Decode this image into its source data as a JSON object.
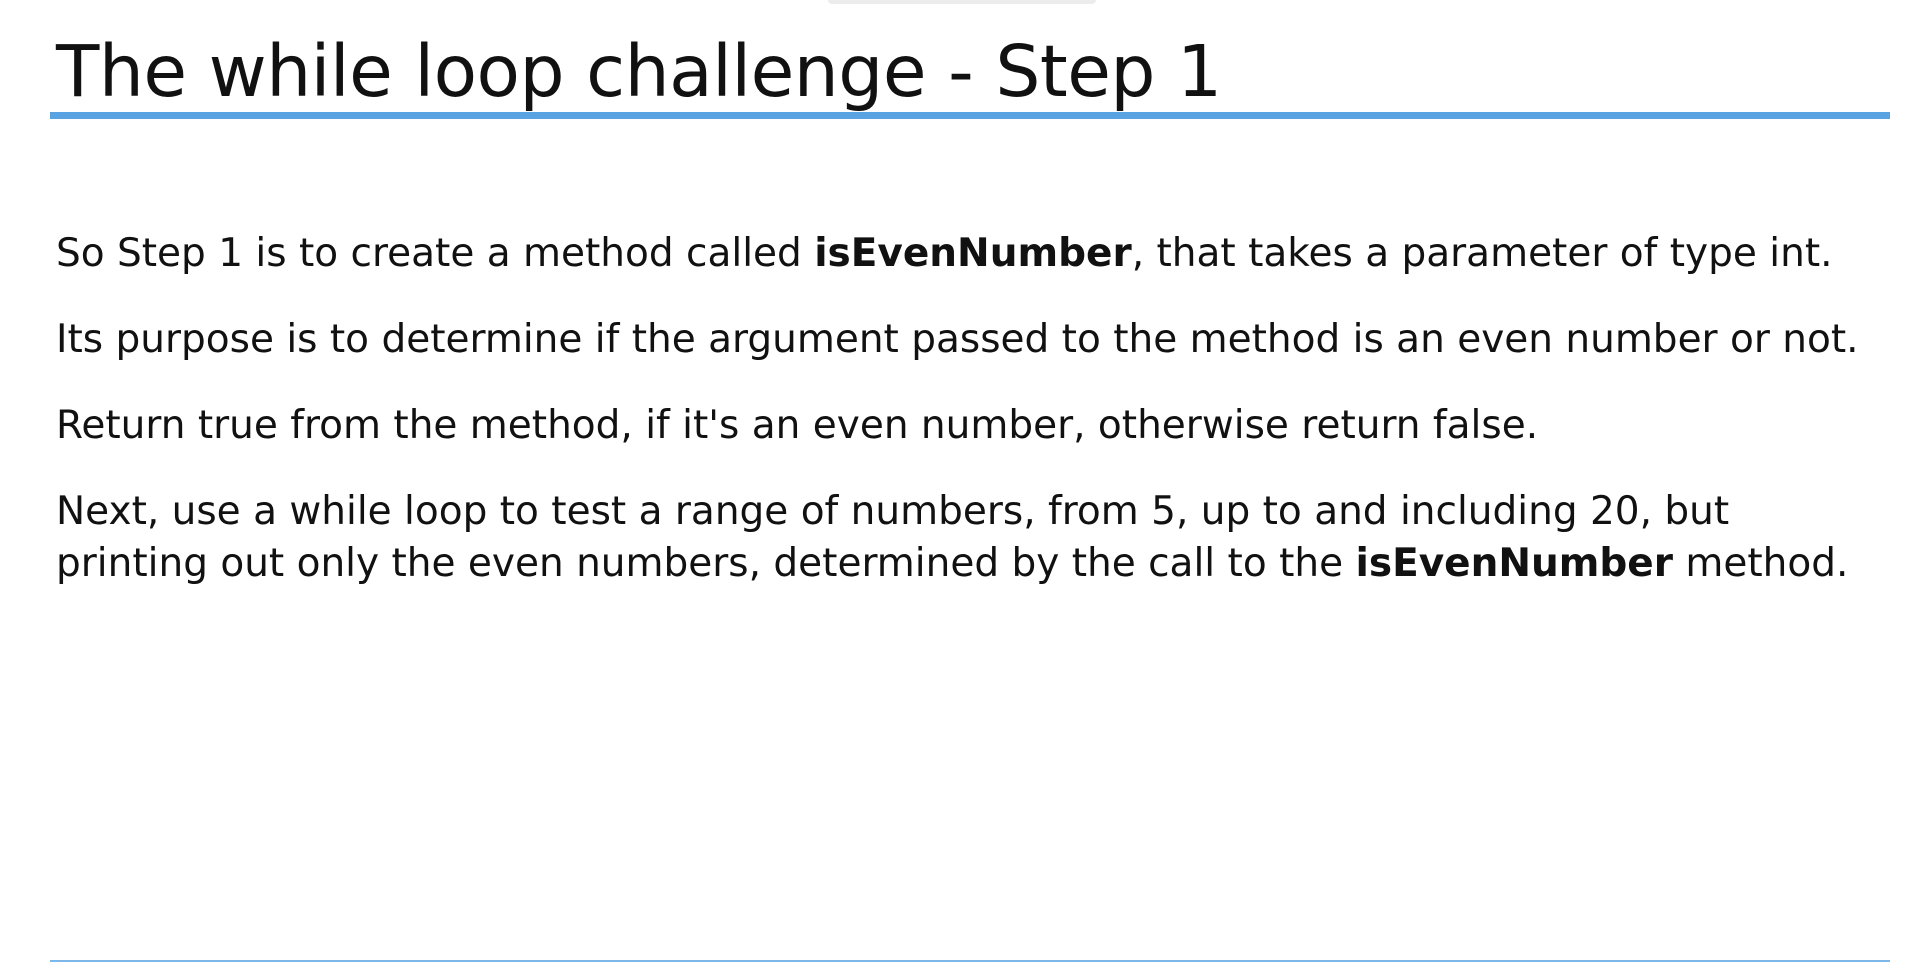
{
  "slide": {
    "title": "The while loop challenge - Step 1",
    "accent_color": "#5aa3e3",
    "paragraphs": [
      {
        "before": "So Step 1 is to create a method called ",
        "bold": "isEvenNumber",
        "after": ", that takes a parameter of type int."
      },
      {
        "text": "Its purpose is to determine if the argument passed to the method is  an even number or not."
      },
      {
        "text": "Return true from the method, if it's an even number, otherwise return false."
      },
      {
        "before": "Next, use a while loop to test a range of numbers, from 5, up to and including 20, but printing out only the even numbers, determined by the call to the ",
        "bold": "isEvenNumber",
        "after": " method."
      }
    ]
  }
}
